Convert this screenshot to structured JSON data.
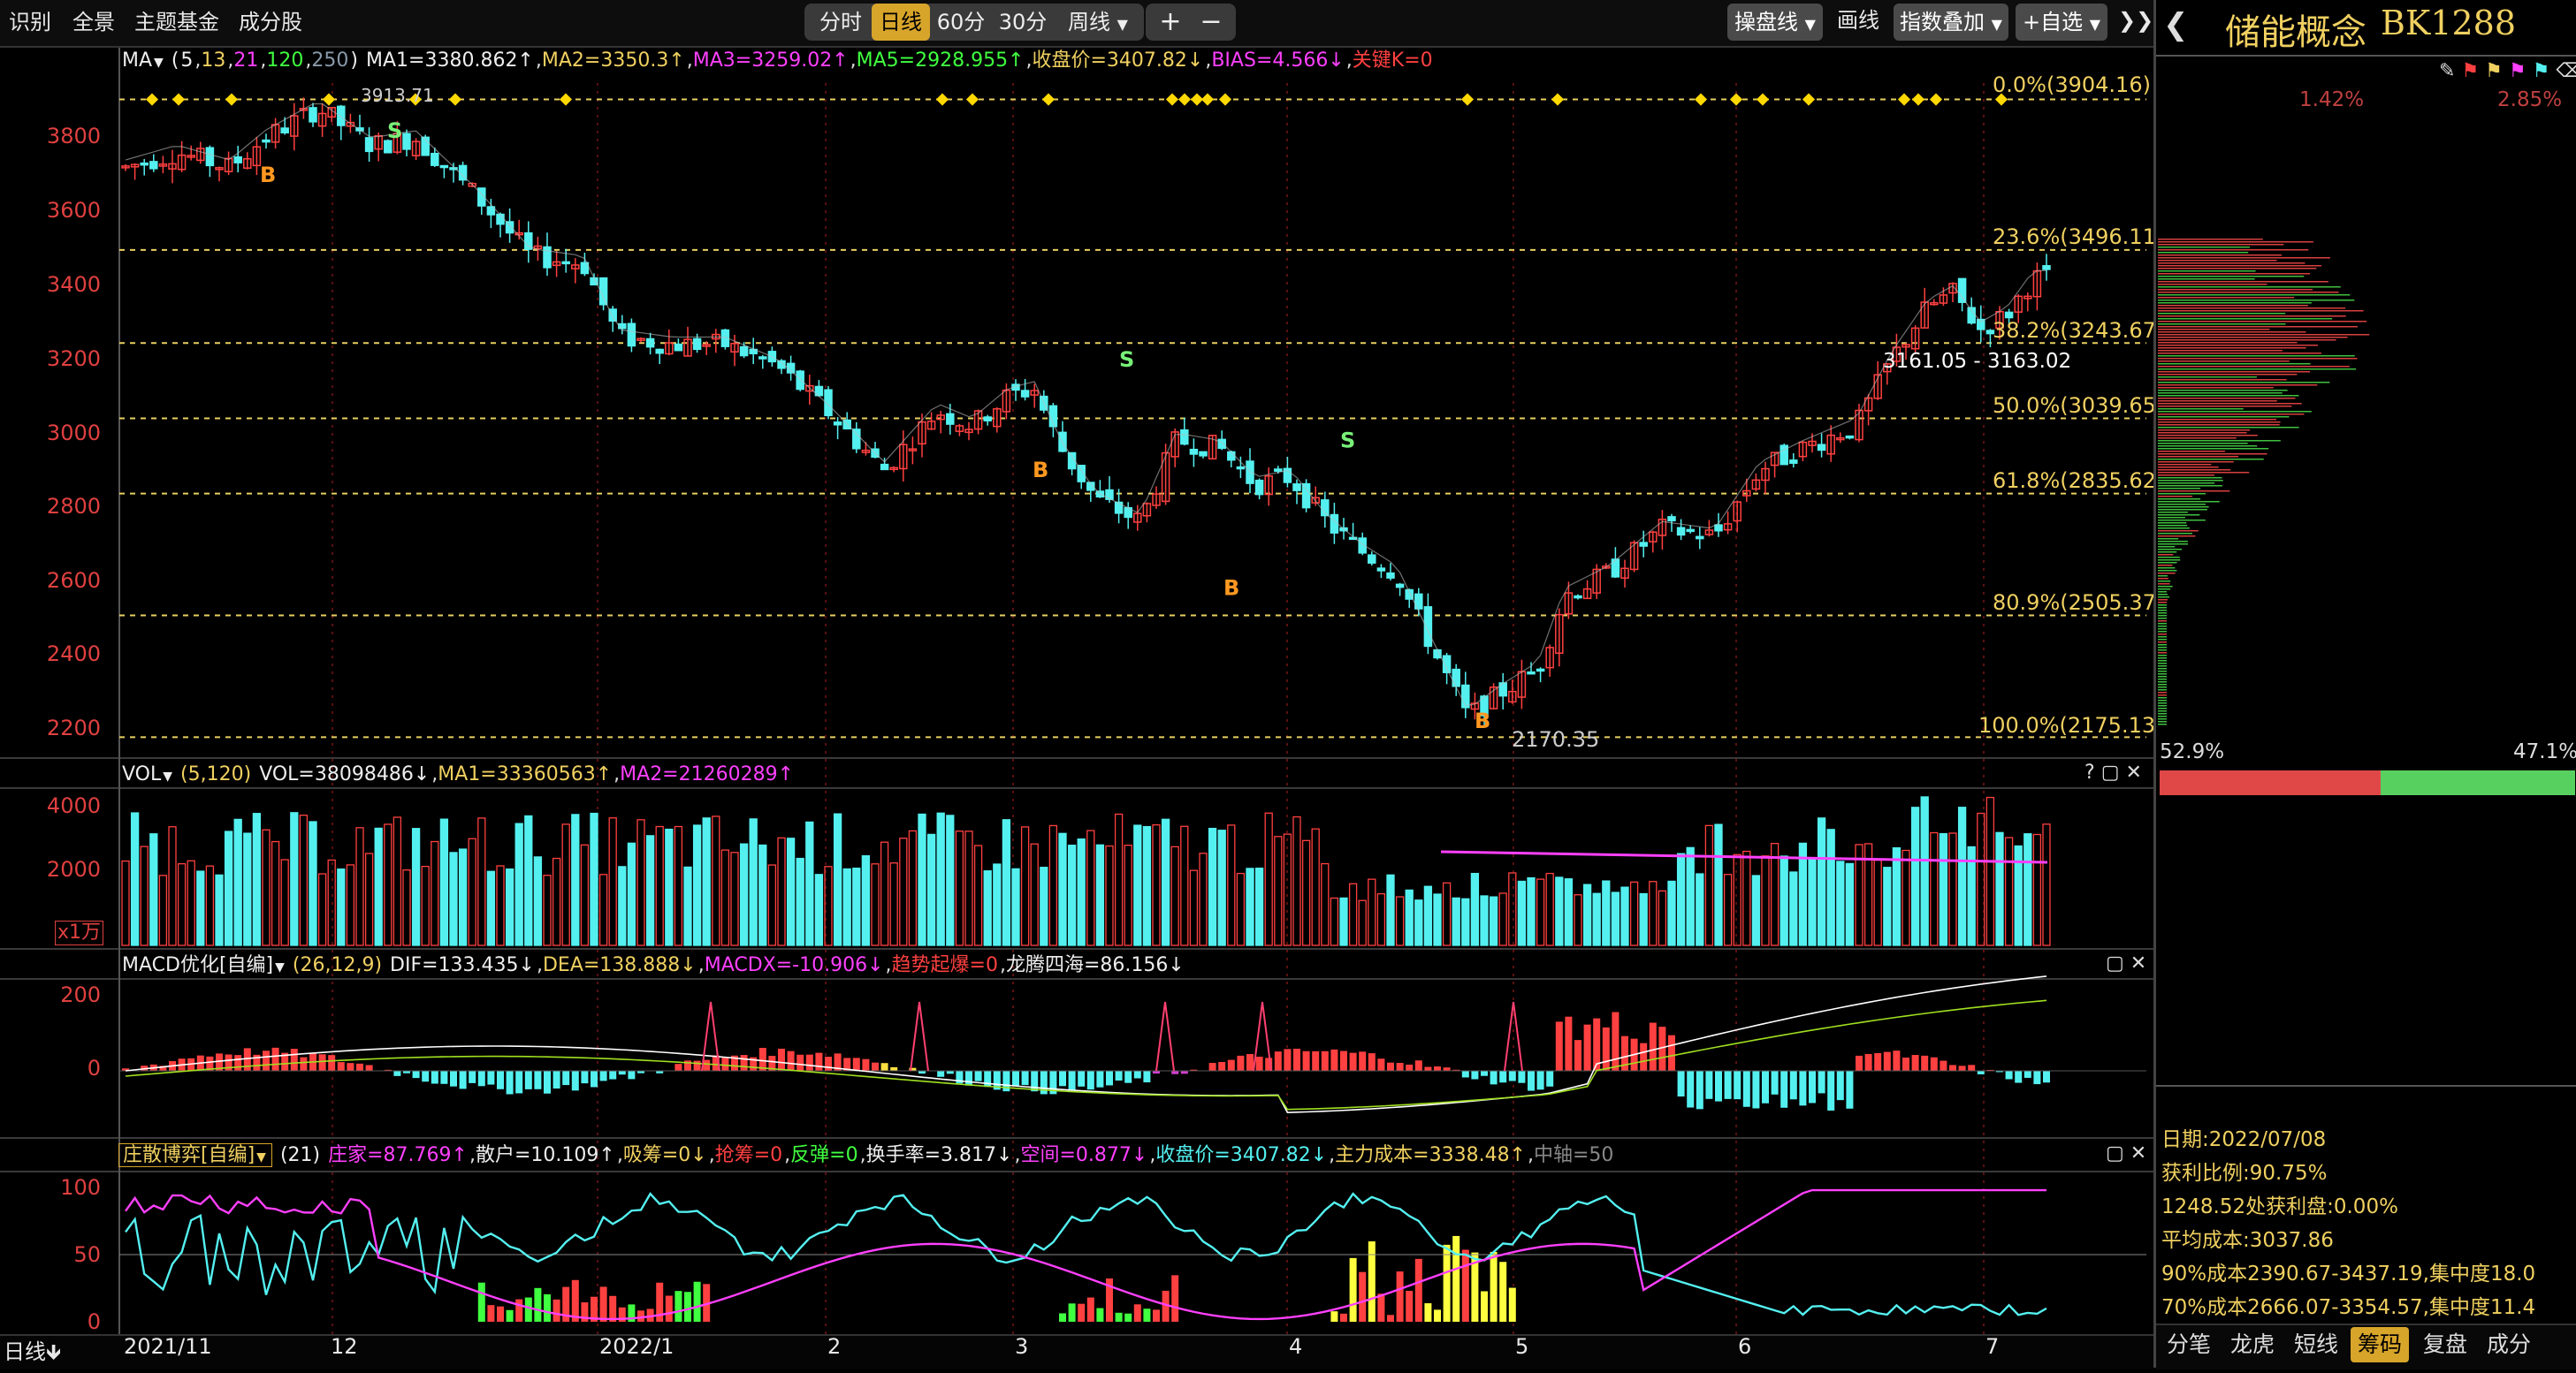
{
  "toolbar": {
    "left_items": [
      "识别",
      "全景",
      "主题基金",
      "成分股"
    ],
    "periods": [
      "分时",
      "日线",
      "60分",
      "30分"
    ],
    "active_period": "日线",
    "week_label": "周线",
    "zoom_in": "+",
    "zoom_out": "−",
    "trade_line": "操盘线",
    "draw_line": "画线",
    "index_overlay": "指数叠加",
    "add_self": "+自选",
    "collapse": "❯❯"
  },
  "main": {
    "ma_header": {
      "name": "MA",
      "params_open": "(",
      "p1": "5",
      "p2": "13",
      "p3": "21",
      "p4": "120",
      "p5": "250",
      "params_close": ")",
      "ma1": "MA1=3380.862↑",
      "ma2": "MA2=3350.3↑",
      "ma3": "MA3=3259.02↑",
      "ma5": "MA5=2928.955↑",
      "close": "收盘价=3407.82↓",
      "bias": "BIAS=4.566↓",
      "key": "关键K=0"
    },
    "y_ticks": [
      "3800",
      "3600",
      "3400",
      "3200",
      "3000",
      "2800",
      "2600",
      "2400",
      "2200"
    ],
    "fib_levels": [
      "0.0%(3904.16)",
      "23.6%(3496.11)",
      "38.2%(3243.67)",
      "50.0%(3039.65)",
      "61.8%(2835.62)",
      "80.9%(2505.37)",
      "100.0%(2175.13)"
    ],
    "high_label": "3913.71",
    "low_label": "2170.35",
    "range_label": "3161.05 - 3163.02",
    "markers": {
      "buy": "B",
      "sell": "S"
    }
  },
  "vol": {
    "header_name": "VOL",
    "params": "(5,120)",
    "vol": "VOL=38098486↓",
    "ma1": "MA1=33360563↑",
    "ma2": "MA2=21260289↑",
    "y_ticks": [
      "4000",
      "2000"
    ],
    "unit": "x1万"
  },
  "macd": {
    "header_name": "MACD优化[自编]",
    "params": "(26,12,9)",
    "dif": "DIF=133.435↓",
    "dea": "DEA=138.888↓",
    "macdx": "MACDX=-10.906↓",
    "trend": "趋势起爆=0",
    "dragon": "龙腾四海=86.156↓",
    "y_ticks": [
      "200",
      "0"
    ]
  },
  "game": {
    "header_name": "庄散博弈[自编]",
    "params": "(21)",
    "dealer": "庄家=87.769↑",
    "retail": "散户=10.109↑",
    "absorb": "吸筹=0↓",
    "grab": "抢筹=0",
    "rebound": "反弹=0",
    "turnover": "换手率=3.817↓",
    "short": "空间=0.877↓",
    "close": "收盘价=3407.82↓",
    "cost": "主力成本=3338.48↑",
    "axis": "中轴=50",
    "y_ticks": [
      "100",
      "50",
      "0"
    ]
  },
  "x_labels": [
    "2021/11",
    "12",
    "2022/1",
    "2",
    "3",
    "4",
    "5",
    "6",
    "7"
  ],
  "bottom_label": "日线",
  "bottom_arrow": "🡻",
  "right": {
    "back": "❮",
    "title": "储能概念",
    "code": "BK1288",
    "pct_left": "1.42%",
    "pct_right": "2.85%",
    "ratio_left": "52.9%",
    "ratio_right": "47.1%",
    "info": [
      "日期:2022/07/08",
      "获利比例:90.75%",
      "1248.52处获利盘:0.00%",
      "平均成本:3037.86",
      "90%成本2390.67-3437.19,集中度18.0",
      "70%成本2666.07-3354.57,集中度11.4"
    ],
    "tabs": [
      "分笔",
      "龙虎",
      "短线",
      "筹码",
      "复盘",
      "成分"
    ],
    "active_tab": "筹码"
  },
  "colors": {
    "up": "#ff4040",
    "down": "#54f0f0",
    "accent": "#d7a52a",
    "fib": "#f0d060",
    "magenta": "#ff40ff"
  }
}
